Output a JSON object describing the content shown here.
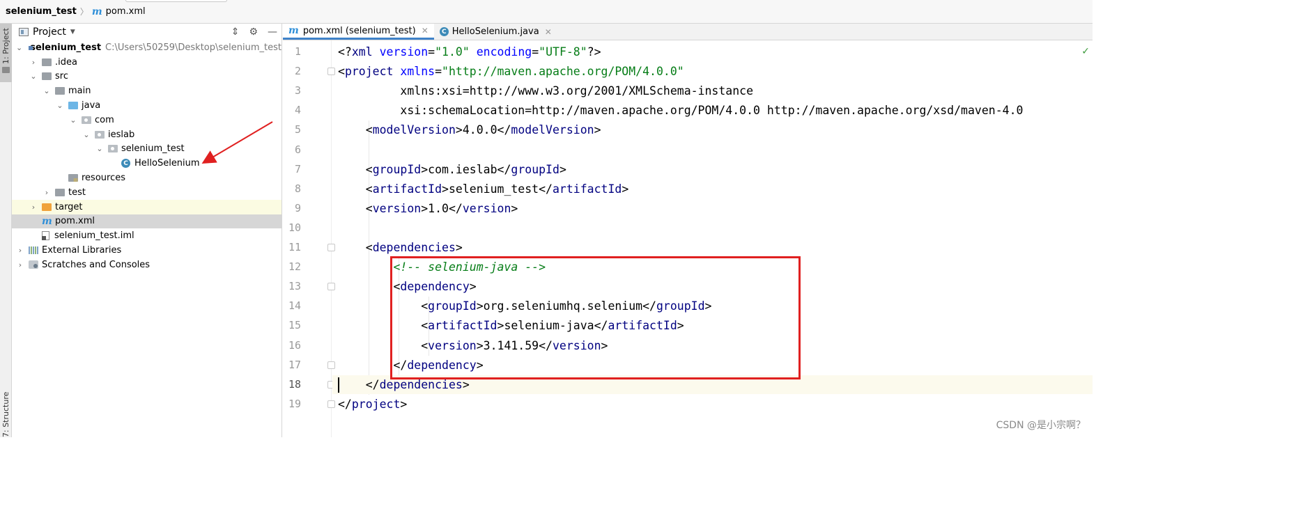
{
  "breadcrumb": {
    "project": "selenium_test",
    "file_icon": "m-icon",
    "file": "pom.xml"
  },
  "tool_strip": {
    "project": "1: Project",
    "structure": "7: Structure"
  },
  "project_panel": {
    "title": "Project",
    "tree": [
      {
        "label": "selenium_test",
        "path": "C:\\Users\\50259\\Desktop\\selenium_test"
      },
      {
        "label": ".idea"
      },
      {
        "label": "src"
      },
      {
        "label": "main"
      },
      {
        "label": "java"
      },
      {
        "label": "com"
      },
      {
        "label": "ieslab"
      },
      {
        "label": "selenium_test"
      },
      {
        "label": "HelloSelenium"
      },
      {
        "label": "resources"
      },
      {
        "label": "test"
      },
      {
        "label": "target"
      },
      {
        "label": "pom.xml"
      },
      {
        "label": "selenium_test.iml"
      },
      {
        "label": "External Libraries"
      },
      {
        "label": "Scratches and Consoles"
      }
    ]
  },
  "editor": {
    "tabs": [
      {
        "label": "pom.xml (selenium_test)",
        "icon": "m-icon"
      },
      {
        "label": "HelloSelenium.java",
        "icon": "class-icon"
      }
    ],
    "current_line": 18,
    "lines": [
      {
        "n": 1,
        "text": "<?xml version=\"1.0\" encoding=\"UTF-8\"?>"
      },
      {
        "n": 2,
        "text": "<project xmlns=\"http://maven.apache.org/POM/4.0.0\""
      },
      {
        "n": 3,
        "text": "         xmlns:xsi=\"http://www.w3.org/2001/XMLSchema-instance\""
      },
      {
        "n": 4,
        "text": "         xsi:schemaLocation=\"http://maven.apache.org/POM/4.0.0 http://maven.apache.org/xsd/maven-4.0"
      },
      {
        "n": 5,
        "text": "    <modelVersion>4.0.0</modelVersion>"
      },
      {
        "n": 6,
        "text": ""
      },
      {
        "n": 7,
        "text": "    <groupId>com.ieslab</groupId>"
      },
      {
        "n": 8,
        "text": "    <artifactId>selenium_test</artifactId>"
      },
      {
        "n": 9,
        "text": "    <version>1.0</version>"
      },
      {
        "n": 10,
        "text": ""
      },
      {
        "n": 11,
        "text": "    <dependencies>"
      },
      {
        "n": 12,
        "text": "        <!-- selenium-java -->"
      },
      {
        "n": 13,
        "text": "        <dependency>"
      },
      {
        "n": 14,
        "text": "            <groupId>org.seleniumhq.selenium</groupId>"
      },
      {
        "n": 15,
        "text": "            <artifactId>selenium-java</artifactId>"
      },
      {
        "n": 16,
        "text": "            <version>3.141.59</version>"
      },
      {
        "n": 17,
        "text": "        </dependency>"
      },
      {
        "n": 18,
        "text": "    </dependencies>"
      },
      {
        "n": 19,
        "text": "</project>"
      }
    ]
  },
  "watermark": "CSDN @是小宗啊？",
  "colors": {
    "tag": "#000080",
    "attribute": "#0000ff",
    "value": "#067d17",
    "comment": "#067d17",
    "highlight_box": "#e02020",
    "tab_underline": "#4083c9"
  }
}
